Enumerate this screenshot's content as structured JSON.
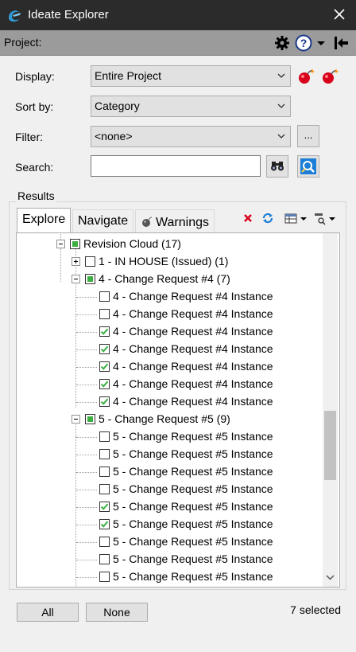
{
  "window": {
    "title": "Ideate Explorer"
  },
  "project": {
    "label": "Project:"
  },
  "form": {
    "display_label": "Display:",
    "display_value": "Entire Project",
    "sort_label": "Sort by:",
    "sort_value": "Category",
    "filter_label": "Filter:",
    "filter_value": "<none>",
    "filter_more": "...",
    "search_label": "Search:",
    "search_value": ""
  },
  "results": {
    "label": "Results",
    "tabs": [
      "Explore",
      "Navigate",
      "Warnings"
    ],
    "active_tab": "Explore"
  },
  "tree": [
    {
      "label": "Revision Cloud (17)",
      "level": 0,
      "expander": "minus",
      "check": "partial"
    },
    {
      "label": "1 - IN HOUSE (Issued) (1)",
      "level": 1,
      "expander": "plus",
      "check": "none"
    },
    {
      "label": "4 - Change Request #4 (7)",
      "level": 1,
      "expander": "minus",
      "check": "partial"
    },
    {
      "label": "4 - Change Request #4 Instance",
      "level": 2,
      "check": "none"
    },
    {
      "label": "4 - Change Request #4 Instance",
      "level": 2,
      "check": "none"
    },
    {
      "label": "4 - Change Request #4 Instance",
      "level": 2,
      "check": "checked"
    },
    {
      "label": "4 - Change Request #4 Instance",
      "level": 2,
      "check": "checked"
    },
    {
      "label": "4 - Change Request #4 Instance",
      "level": 2,
      "check": "checked"
    },
    {
      "label": "4 - Change Request #4 Instance",
      "level": 2,
      "check": "checked"
    },
    {
      "label": "4 - Change Request #4 Instance",
      "level": 2,
      "check": "checked"
    },
    {
      "label": "5 - Change Request #5 (9)",
      "level": 1,
      "expander": "minus",
      "check": "partial"
    },
    {
      "label": "5 - Change Request #5 Instance",
      "level": 2,
      "check": "none"
    },
    {
      "label": "5 - Change Request #5 Instance",
      "level": 2,
      "check": "none"
    },
    {
      "label": "5 - Change Request #5 Instance",
      "level": 2,
      "check": "none"
    },
    {
      "label": "5 - Change Request #5 Instance",
      "level": 2,
      "check": "none"
    },
    {
      "label": "5 - Change Request #5 Instance",
      "level": 2,
      "check": "checked"
    },
    {
      "label": "5 - Change Request #5 Instance",
      "level": 2,
      "check": "checked"
    },
    {
      "label": "5 - Change Request #5 Instance",
      "level": 2,
      "check": "none"
    },
    {
      "label": "5 - Change Request #5 Instance",
      "level": 2,
      "check": "none"
    },
    {
      "label": "5 - Change Request #5 Instance",
      "level": 2,
      "check": "none"
    }
  ],
  "footer": {
    "all_label": "All",
    "none_label": "None",
    "status": "7 selected"
  },
  "icons": {
    "app": "ideate-logo-icon",
    "close": "close-icon",
    "settings": "gear-icon",
    "help": "help-icon",
    "dock": "dock-collapse-icon",
    "clear_filter": "bomb-icon",
    "select_in_view": "binoculars-icon",
    "zoom": "zoom-to-icon",
    "clear_results": "red-x-icon",
    "refresh": "refresh-icon",
    "columns": "columns-icon",
    "find_options": "find-options-icon"
  },
  "colors": {
    "titlebar": "#2b2b2b",
    "projectbar": "#9b9b9b",
    "check_green": "#3cb043",
    "accent_red": "#d9001b",
    "accent_blue": "#1c7ed6"
  }
}
